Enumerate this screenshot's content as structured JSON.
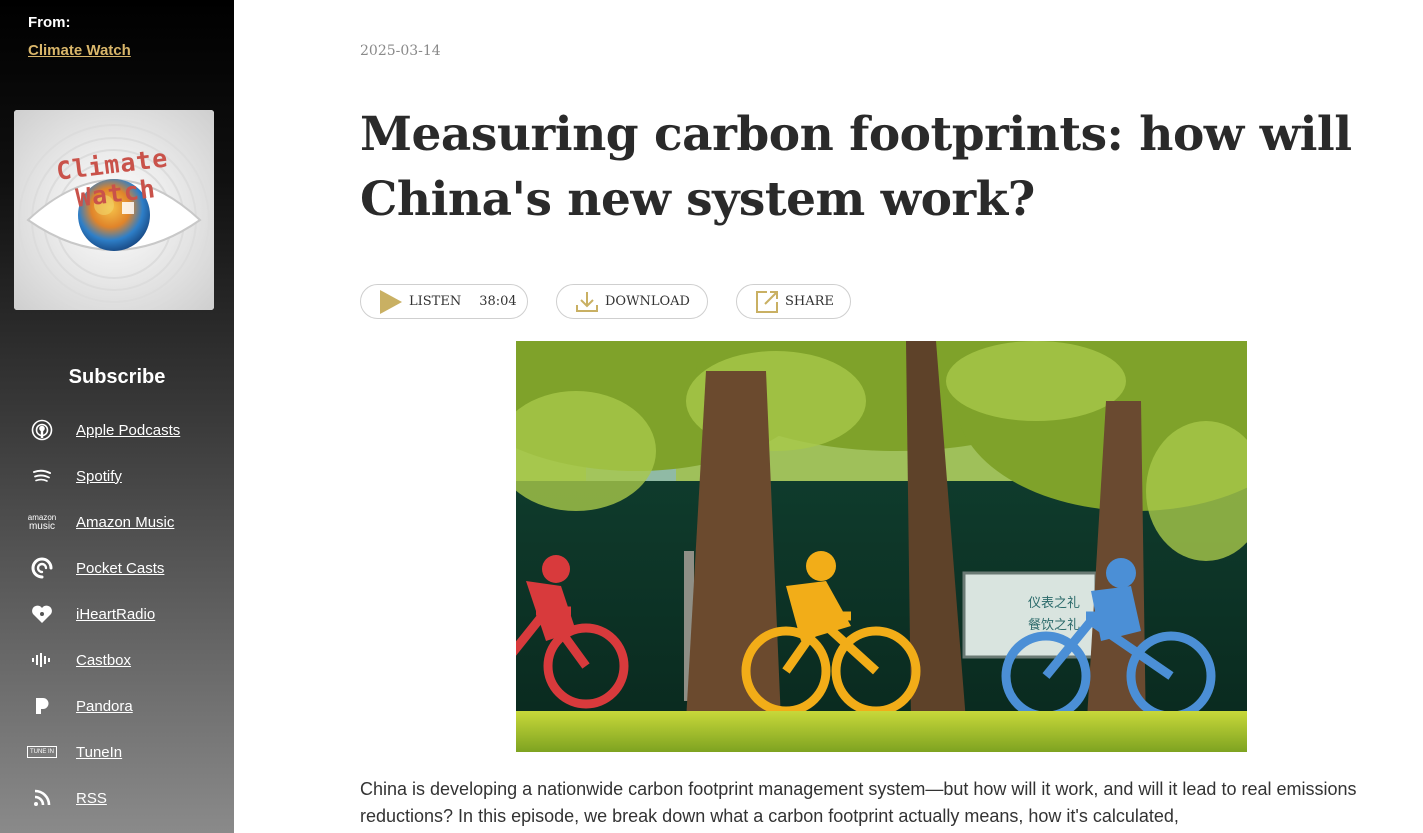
{
  "sidebar": {
    "from_label": "From:",
    "from_link": "Climate Watch",
    "cover_text": "Climate Watch",
    "subscribe_title": "Subscribe",
    "platforms": [
      {
        "label": "Apple Podcasts",
        "icon": "apple-podcasts-icon"
      },
      {
        "label": "Spotify",
        "icon": "spotify-icon"
      },
      {
        "label": "Amazon Music",
        "icon": "amazon-music-icon",
        "icon_text": [
          "amazon",
          "music"
        ]
      },
      {
        "label": "Pocket Casts",
        "icon": "pocket-casts-icon"
      },
      {
        "label": "iHeartRadio",
        "icon": "iheartradio-icon"
      },
      {
        "label": "Castbox",
        "icon": "castbox-icon"
      },
      {
        "label": "Pandora",
        "icon": "pandora-icon"
      },
      {
        "label": "TuneIn",
        "icon": "tunein-icon",
        "icon_text": "TUNE IN"
      },
      {
        "label": "RSS",
        "icon": "rss-icon"
      }
    ]
  },
  "article": {
    "date": "2025-03-14",
    "title": "Measuring carbon footprints: how will China's new system work?",
    "listen_label": "LISTEN",
    "duration": "38:04",
    "download_label": "DOWNLOAD",
    "share_label": "SHARE",
    "image_sign": [
      "仪表之礼",
      "餐饮之礼"
    ],
    "intro": "China is developing a nationwide carbon footprint management system—but how will it work, and will it lead to real emissions reductions? In this episode, we break down what a carbon footprint actually means, how it's calculated,"
  },
  "colors": {
    "accent": "#c9b063",
    "link": "#d9b66a",
    "bike_red": "#d83a3c",
    "bike_yellow": "#f2ad18",
    "bike_blue": "#4b8fd6"
  }
}
